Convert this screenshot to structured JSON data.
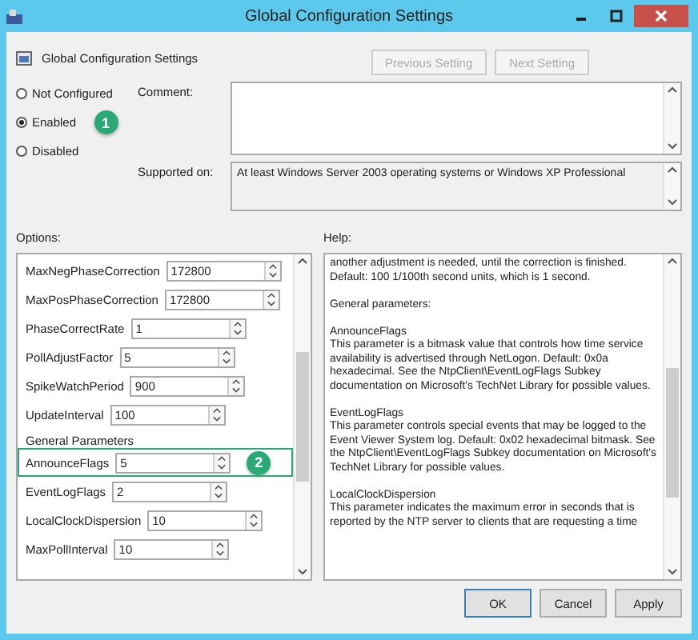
{
  "window": {
    "title": "Global Configuration Settings"
  },
  "header": {
    "title": "Global Configuration Settings",
    "buttons": [
      {
        "label": "Previous Setting",
        "disabled": true
      },
      {
        "label": "Next Setting",
        "disabled": true
      }
    ]
  },
  "state_options": [
    {
      "label": "Not Configured",
      "selected": false
    },
    {
      "label": "Enabled",
      "selected": true,
      "badge": "1"
    },
    {
      "label": "Disabled",
      "selected": false
    }
  ],
  "comment": {
    "label": "Comment:"
  },
  "supported_on": {
    "label": "Supported on:",
    "value": "At least Windows Server 2003 operating systems or Windows XP Professional"
  },
  "options": {
    "label": "Options:",
    "rows": [
      {
        "kind": "field",
        "label": "MaxNegPhaseCorrection",
        "value": "172800",
        "highlighted": false
      },
      {
        "kind": "field",
        "label": "MaxPosPhaseCorrection",
        "value": "172800",
        "highlighted": false
      },
      {
        "kind": "field",
        "label": "PhaseCorrectRate",
        "value": "1",
        "highlighted": false
      },
      {
        "kind": "field",
        "label": "PollAdjustFactor",
        "value": "5",
        "highlighted": false
      },
      {
        "kind": "field",
        "label": "SpikeWatchPeriod",
        "value": "900",
        "highlighted": false
      },
      {
        "kind": "field",
        "label": "UpdateInterval",
        "value": "100",
        "highlighted": false
      },
      {
        "kind": "heading",
        "label": "General Parameters"
      },
      {
        "kind": "field",
        "label": "AnnounceFlags",
        "value": "5",
        "highlighted": true,
        "badge": "2"
      },
      {
        "kind": "field",
        "label": "EventLogFlags",
        "value": "2",
        "highlighted": false
      },
      {
        "kind": "field",
        "label": "LocalClockDispersion",
        "value": "10",
        "highlighted": false
      },
      {
        "kind": "field",
        "label": "MaxPollInterval",
        "value": "10",
        "highlighted": false
      }
    ]
  },
  "help": {
    "label": "Help:",
    "paragraphs": [
      {
        "lines": [
          "another adjustment is needed, until the correction is finished. Default: 100 1/100th second units, which is 1 second."
        ]
      },
      {
        "lines": [
          "General parameters:"
        ]
      },
      {
        "lines": [
          "AnnounceFlags",
          "This parameter is a bitmask value that controls how time service availability is advertised through NetLogon. Default: 0x0a hexadecimal. See the NtpClient\\EventLogFlags Subkey documentation on Microsoft's TechNet Library for possible values."
        ]
      },
      {
        "lines": [
          "EventLogFlags",
          "This parameter controls special events that may be logged to the Event Viewer System log. Default: 0x02 hexadecimal bitmask. See the NtpClient\\EventLogFlags Subkey documentation on Microsoft's TechNet Library for possible values."
        ]
      },
      {
        "lines": [
          "LocalClockDispersion",
          "This parameter indicates the maximum error in seconds that is reported by the NTP server to clients that are requesting a time"
        ]
      }
    ]
  },
  "footer": {
    "buttons": [
      "OK",
      "Cancel",
      "Apply"
    ]
  }
}
